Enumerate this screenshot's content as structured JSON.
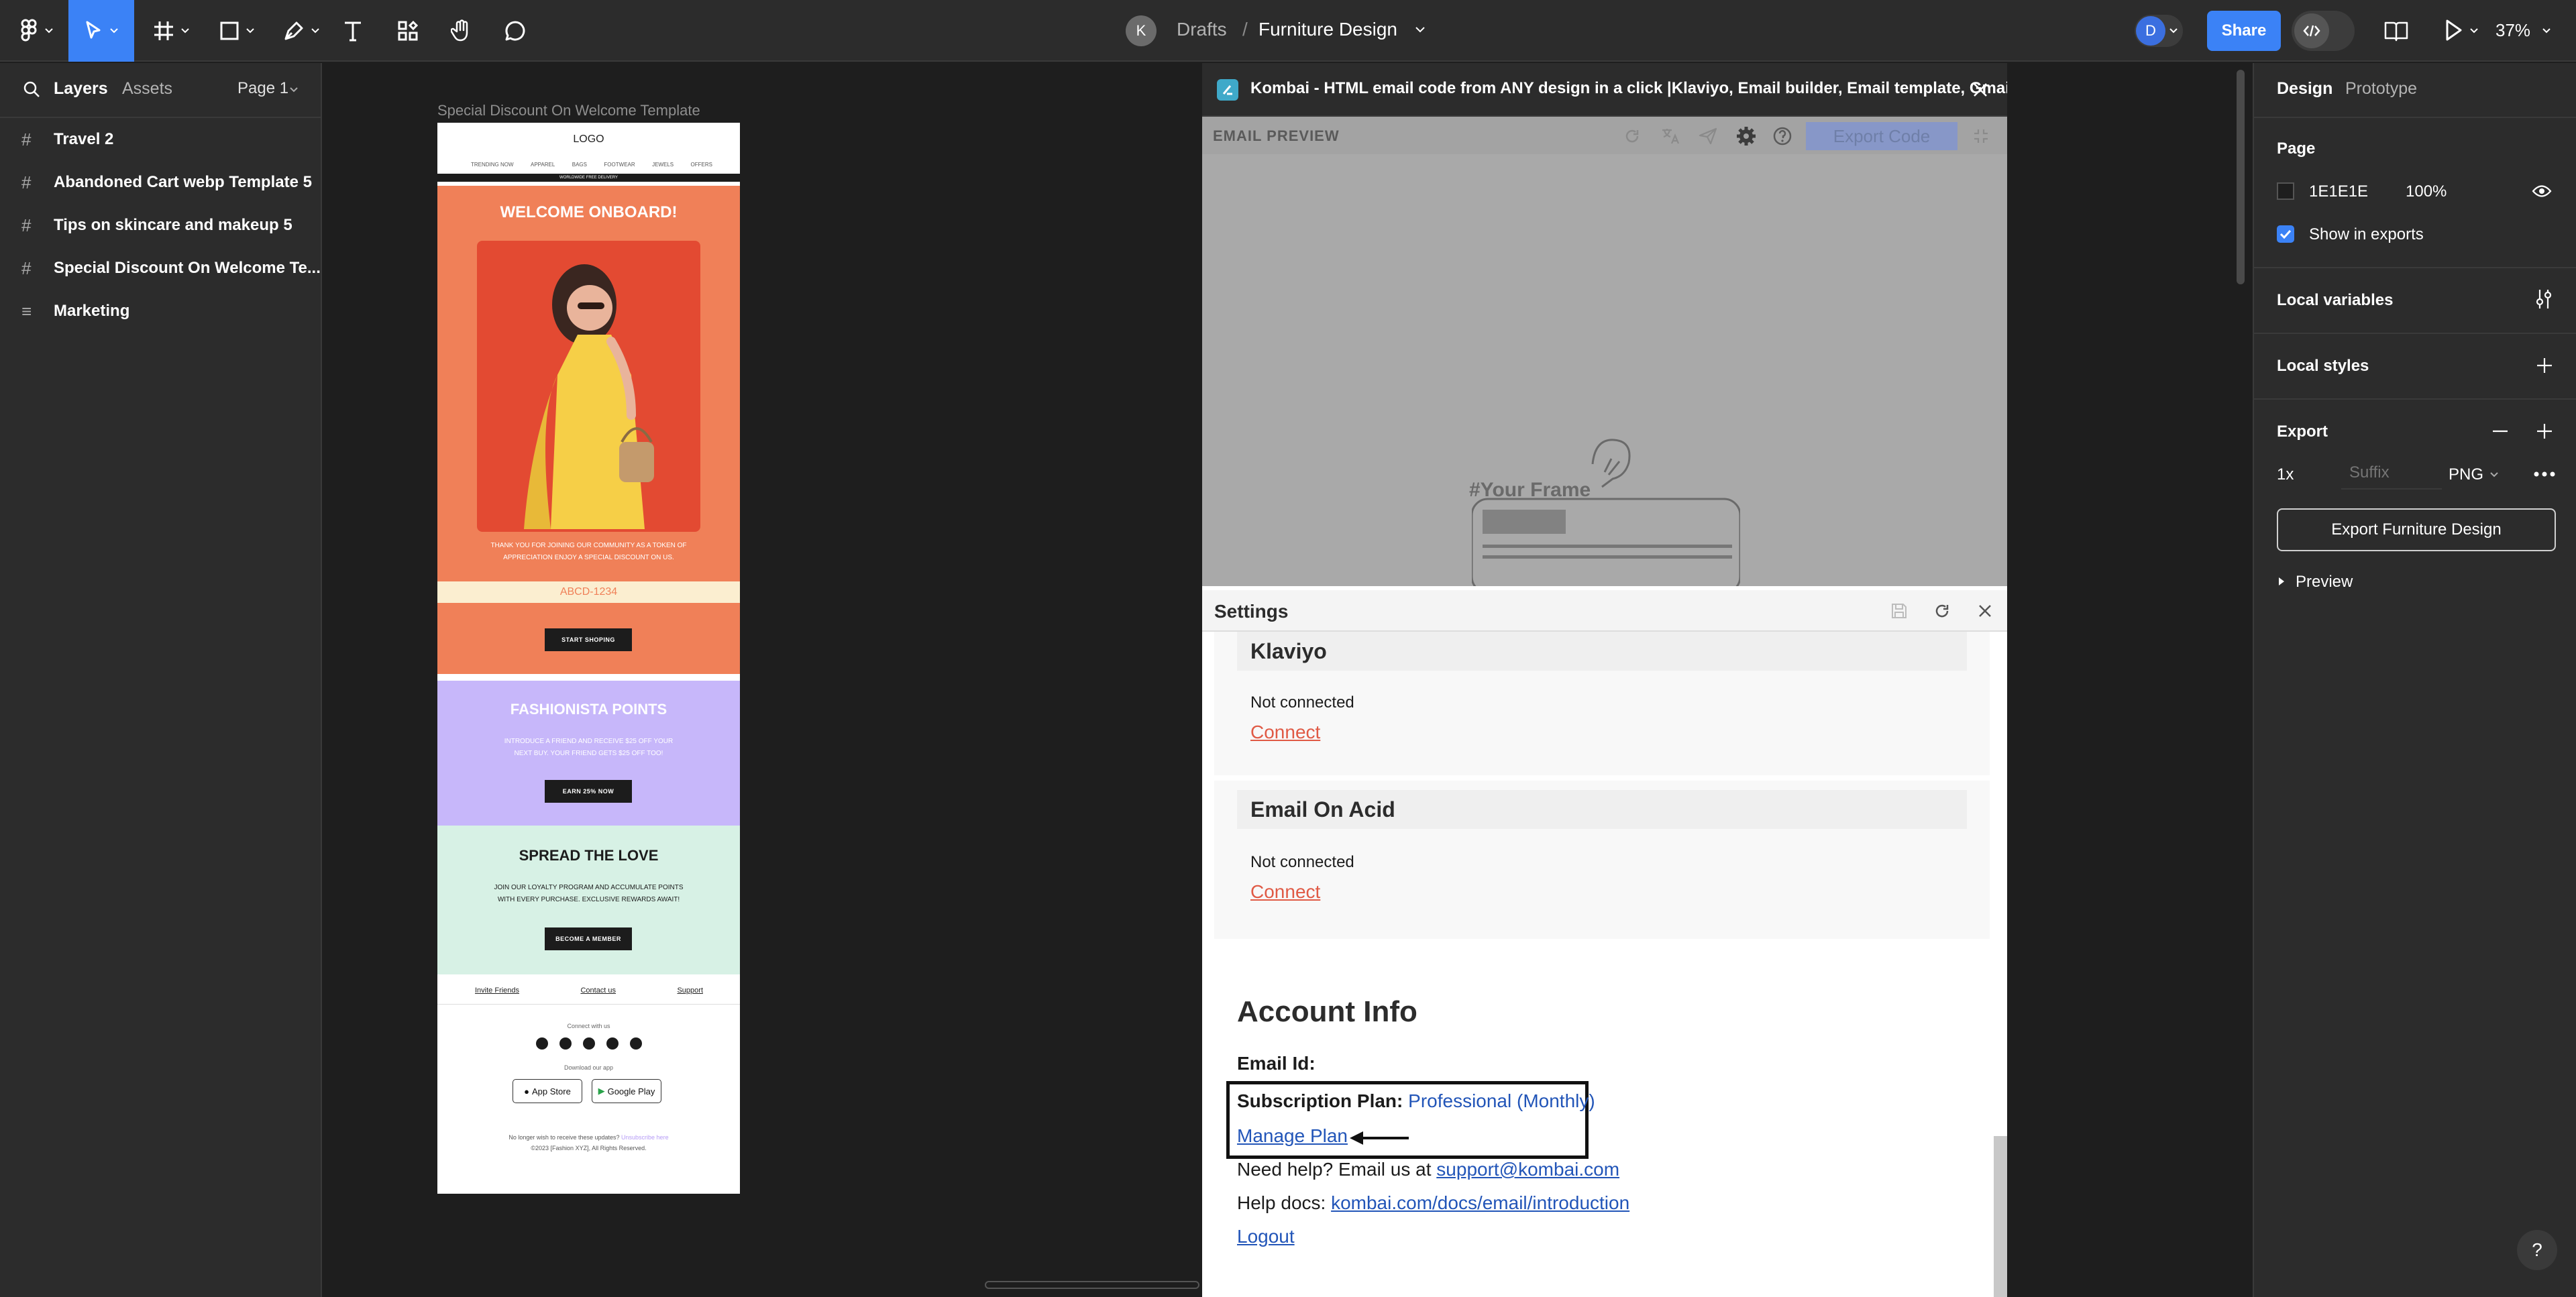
{
  "toolbar": {
    "breadcrumb_avatar": "K",
    "breadcrumb_parent": "Drafts",
    "breadcrumb_sep": "/",
    "file_name": "Furniture Design",
    "user_avatar": "D",
    "share_label": "Share",
    "zoom": "37%"
  },
  "left_panel": {
    "tabs": [
      "Layers",
      "Assets"
    ],
    "page_selector": "Page 1",
    "layers": [
      {
        "name": "Travel 2",
        "type": "frame"
      },
      {
        "name": "Abandoned Cart webp Template 5",
        "type": "frame"
      },
      {
        "name": "Tips on skincare and makeup 5",
        "type": "frame"
      },
      {
        "name": "Special Discount On Welcome Te...",
        "type": "frame"
      },
      {
        "name": "Marketing",
        "type": "section"
      }
    ]
  },
  "canvas": {
    "frame_label": "Special Discount On Welcome Template",
    "email": {
      "logo": "LOGO",
      "nav": [
        "TRENDING NOW",
        "APPAREL",
        "BAGS",
        "FOOTWEAR",
        "JEWELS",
        "OFFERS"
      ],
      "shipping_note": "WORLDWIDE FREE DELIVERY",
      "welcome_title": "WELCOME ONBOARD!",
      "welcome_text_1": "THANK YOU FOR JOINING OUR COMMUNITY AS A TOKEN OF",
      "welcome_text_2": "APPRECIATION ENJOY A SPECIAL DISCOUNT ON US.",
      "coupon_code": "ABCD-1234",
      "start_button": "START SHOPING",
      "points_title": "FASHIONISTA POINTS",
      "points_text_1": "INTRODUCE A FRIEND AND RECEIVE $25 OFF YOUR",
      "points_text_2": "NEXT BUY. YOUR FRIEND GETS $25 OFF TOO!",
      "points_button": "EARN 25% NOW",
      "love_title": "SPREAD THE LOVE",
      "love_text_1": "JOIN OUR LOYALTY PROGRAM AND ACCUMULATE POINTS",
      "love_text_2": "WITH EVERY PURCHASE. EXCLUSIVE REWARDS AWAIT!",
      "love_button": "BECOME A MEMBER",
      "footer_links": [
        "Invite Friends",
        "Contact us",
        "Support"
      ],
      "connect_label": "Connect with us",
      "download_label": "Download our app",
      "app_store": "App Store",
      "google_play": "Google Play",
      "unsubscribe_text": "No longer wish to receive these updates?",
      "unsubscribe_link": "Unsubscribe here",
      "copyright": "©2023 [Fashion XYZ], All Rights Reserved."
    },
    "colors": {
      "welcome_bg": "#f08058",
      "coupon_bg": "#fbeed0",
      "points_bg": "#c7b7fa",
      "love_bg": "#d7f1e5"
    }
  },
  "plugin": {
    "title": "Kombai - HTML email code from ANY design in a click |Klaviyo, Email builder, Email template, Gmail",
    "preview_label": "EMAIL PREVIEW",
    "export_button": "Export Code",
    "placeholder_text": "#Your Frame",
    "settings_title": "Settings",
    "klaviyo": {
      "title": "Klaviyo",
      "status": "Not connected",
      "action": "Connect"
    },
    "email_on_acid": {
      "title": "Email On Acid",
      "status": "Not connected",
      "action": "Connect"
    },
    "account": {
      "title": "Account Info",
      "email_label": "Email Id:",
      "plan_label": "Subscription Plan:",
      "plan_value": "Professional (Monthly)",
      "manage_plan": "Manage Plan",
      "help_label": "Need help? Email us at",
      "help_email": "support@kombai.com",
      "docs_label": "Help docs:",
      "docs_link": "kombai.com/docs/email/introduction",
      "logout": "Logout"
    }
  },
  "right_panel": {
    "tabs": [
      "Design",
      "Prototype"
    ],
    "page_section": "Page",
    "page_color": "1E1E1E",
    "page_opacity": "100%",
    "show_in_exports": "Show in exports",
    "local_variables": "Local variables",
    "local_styles": "Local styles",
    "export_section": "Export",
    "export_scale": "1x",
    "export_suffix_placeholder": "Suffix",
    "export_format": "PNG",
    "export_button": "Export Furniture Design",
    "preview_label": "Preview",
    "help_button": "?"
  }
}
